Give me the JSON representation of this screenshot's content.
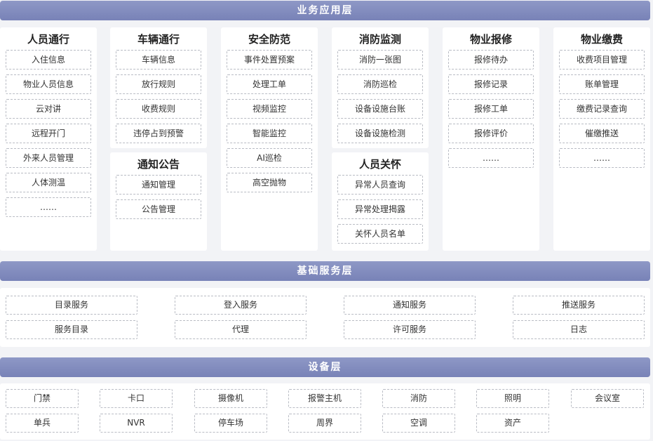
{
  "app_layer": {
    "title": "业务应用层",
    "columns": [
      {
        "title": "人员通行",
        "items": [
          "入住信息",
          "物业人员信息",
          "云对讲",
          "远程开门",
          "外来人员管理",
          "人体测温",
          "……"
        ]
      },
      {
        "title": "车辆通行",
        "items": [
          "车辆信息",
          "放行规则",
          "收费规则",
          "违停占到预警"
        ]
      },
      {
        "title": "通知公告",
        "items": [
          "通知管理",
          "公告管理"
        ]
      },
      {
        "title": "安全防范",
        "items": [
          "事件处置预案",
          "处理工单",
          "视频监控",
          "智能监控",
          "AI巡检",
          "高空抛物"
        ]
      },
      {
        "title": "消防监测",
        "items": [
          "消防一张图",
          "消防巡检",
          "设备设施台账",
          "设备设施检测"
        ]
      },
      {
        "title": "人员关怀",
        "items": [
          "异常人员查询",
          "异常处理揭露",
          "关怀人员名单"
        ]
      },
      {
        "title": "物业报修",
        "items": [
          "报修待办",
          "报修记录",
          "报修工单",
          "报修评价",
          "……"
        ]
      },
      {
        "title": "物业缴费",
        "items": [
          "收费项目管理",
          "账单管理",
          "缴费记录查询",
          "催缴推送",
          "……"
        ]
      }
    ]
  },
  "base_layer": {
    "title": "基础服务层",
    "rows": [
      [
        "目录服务",
        "登入服务",
        "通知服务",
        "推送服务"
      ],
      [
        "服务目录",
        "代理",
        "许可服务",
        "日志"
      ]
    ]
  },
  "device_layer": {
    "title": "设备层",
    "rows": [
      [
        "门禁",
        "卡口",
        "摄像机",
        "报警主机",
        "消防",
        "照明",
        "会议室"
      ],
      [
        "单兵",
        "NVR",
        "停车场",
        "周界",
        "空调",
        "资产"
      ]
    ]
  }
}
